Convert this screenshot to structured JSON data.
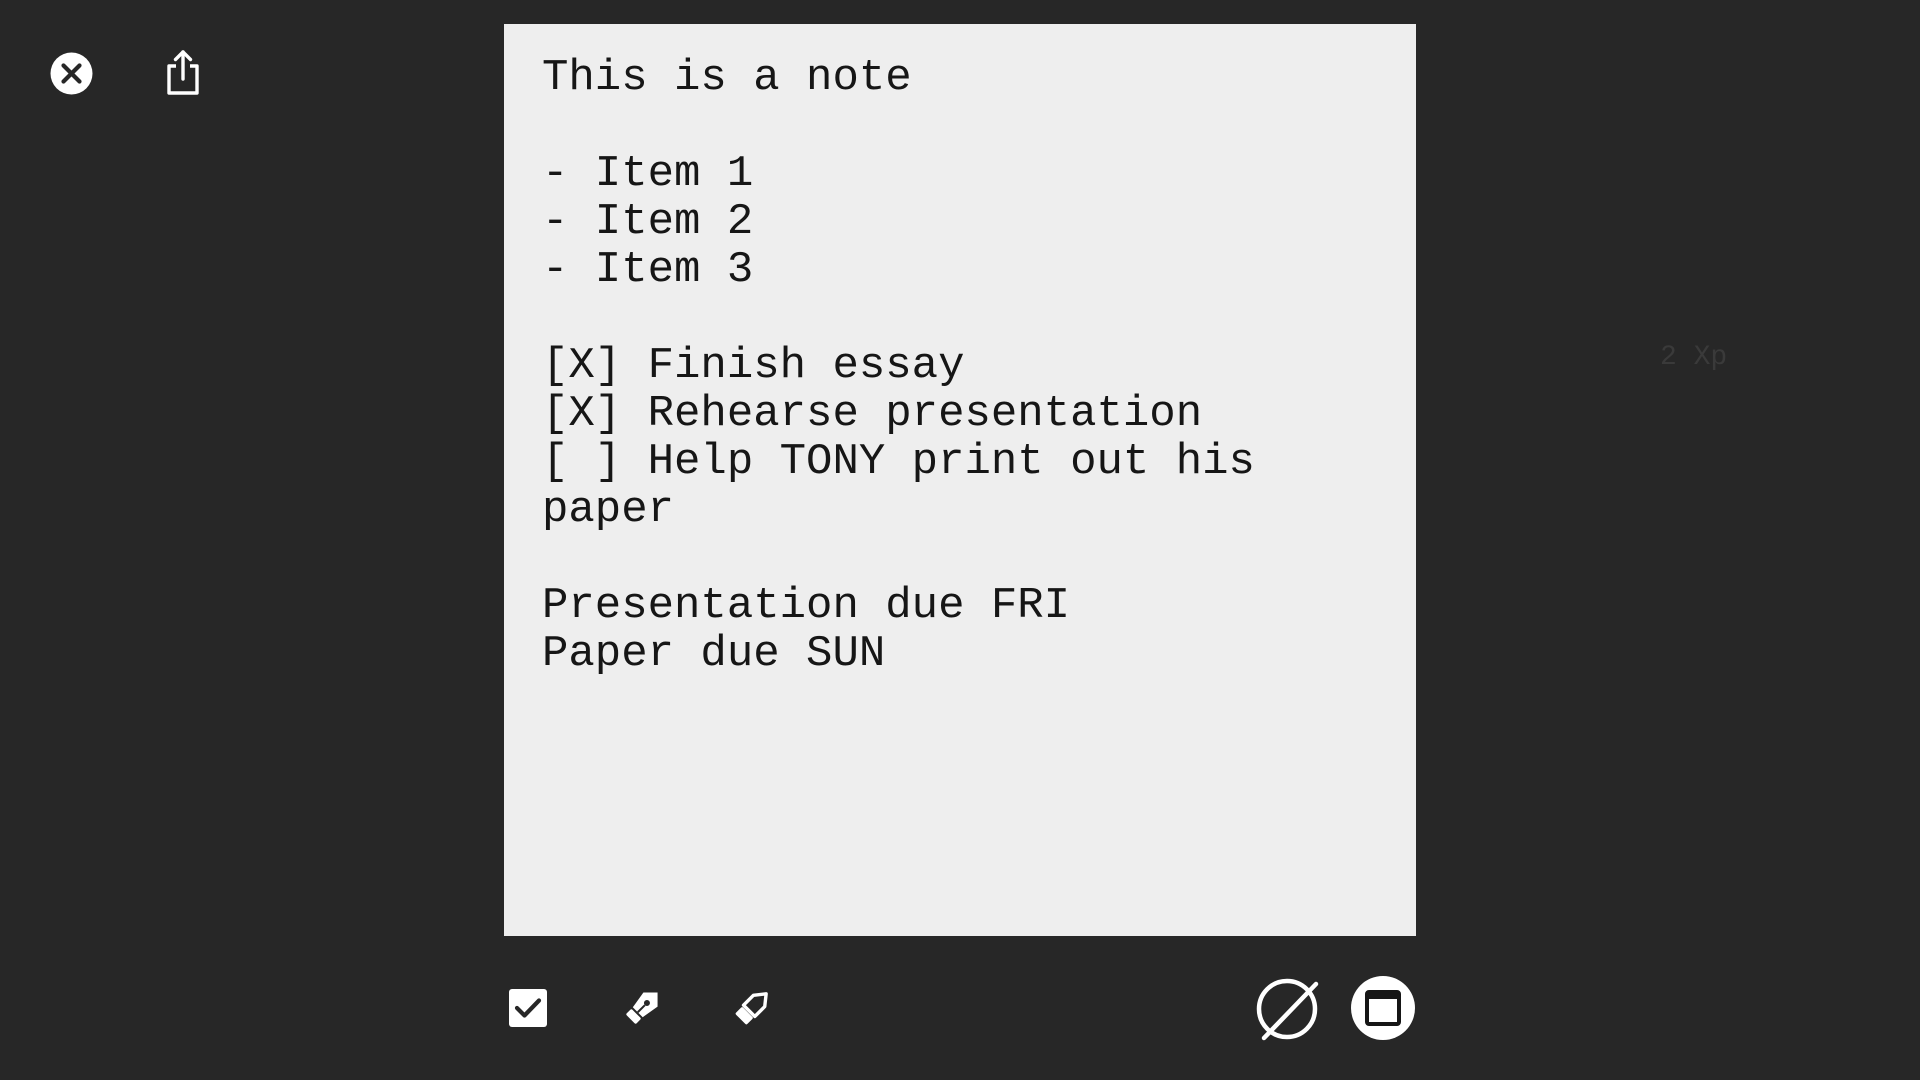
{
  "note": {
    "text": "This is a note\n\n- Item 1\n- Item 2\n- Item 3\n\n[X] Finish essay\n[X] Rehearse presentation\n[ ] Help TONY print out his paper\n\nPresentation due FRI\nPaper due SUN"
  },
  "side_label": "2 Xp",
  "toolbar_top": {
    "close_icon": "close-circle-icon",
    "share_icon": "share-icon"
  },
  "toolbar_bottom": {
    "checkbox_icon": "checkbox-icon",
    "pen_icon": "pen-icon",
    "marker_icon": "marker-icon",
    "no_color_icon": "no-color-icon",
    "frame_icon": "frame-icon"
  },
  "colors": {
    "background": "#272727",
    "paper": "#eeeeee",
    "icon": "#ffffff"
  }
}
